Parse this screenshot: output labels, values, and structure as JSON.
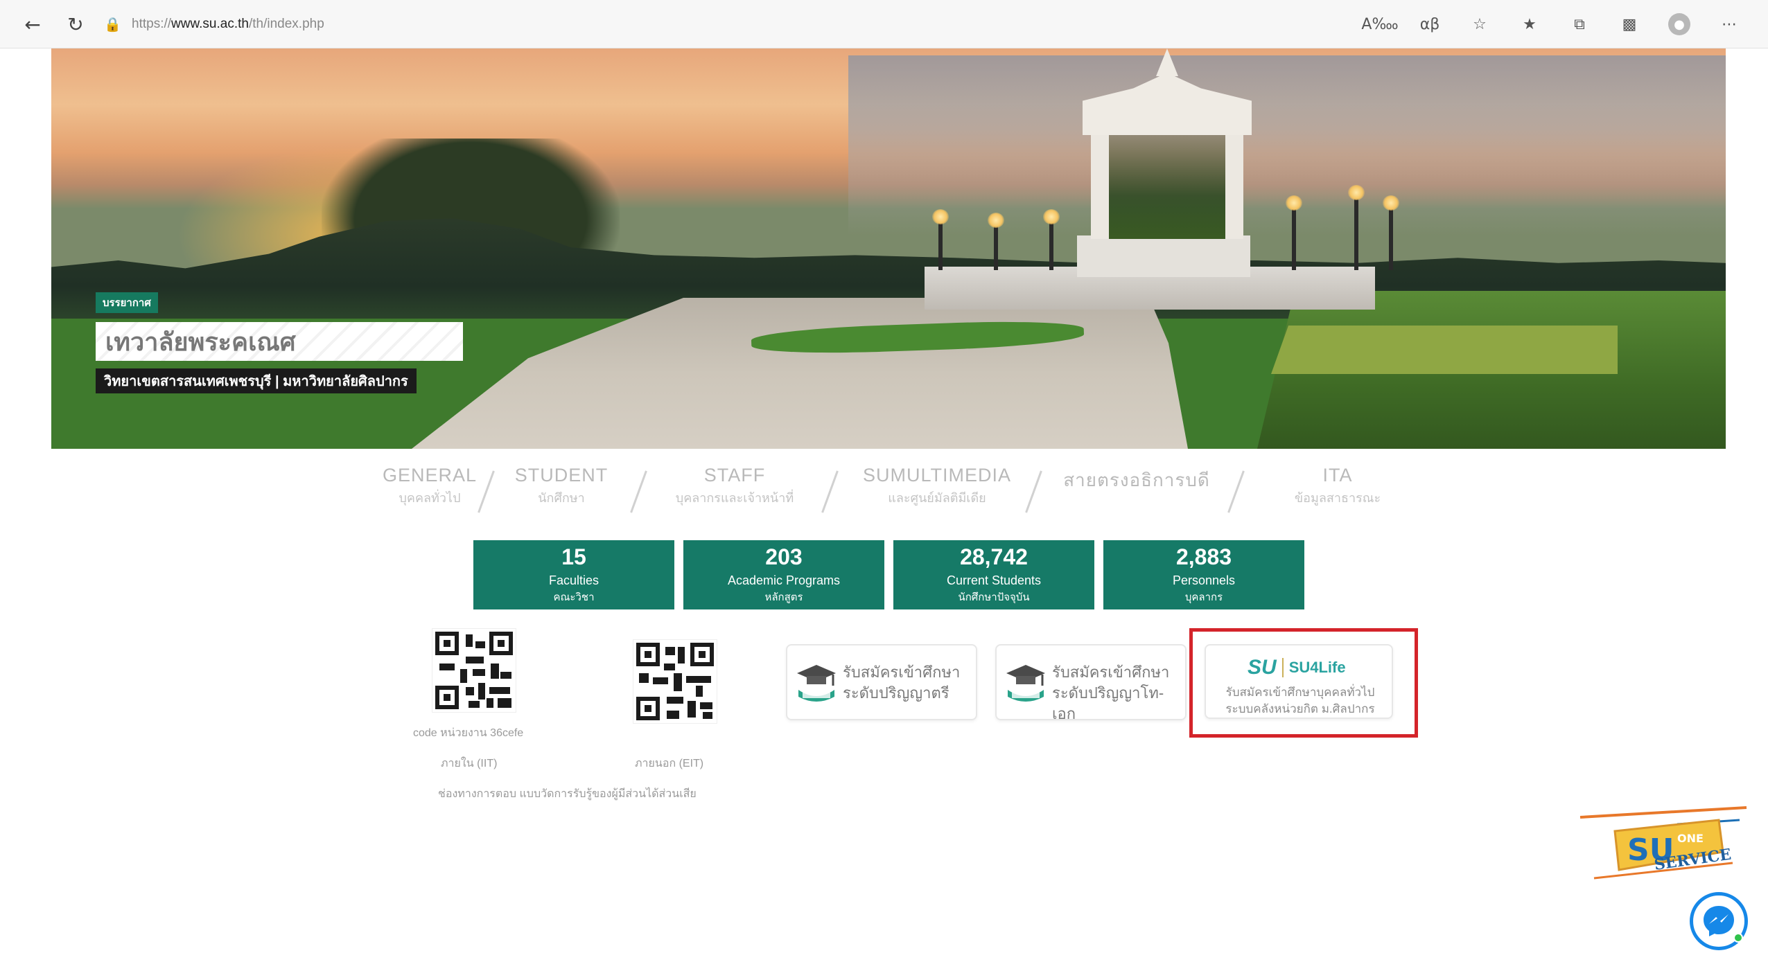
{
  "browser": {
    "url_prefix": "https://",
    "url_host": "www.su.ac.th",
    "url_path": "/th/index.php",
    "icons": [
      "back-icon",
      "reload-icon",
      "lock-icon",
      "read-aloud-icon",
      "translate-icon",
      "add-favorite-icon",
      "favorites-icon",
      "collections-icon",
      "extensions-icon",
      "profile-icon",
      "more-icon"
    ]
  },
  "hero": {
    "tag": "บรรยากาศ",
    "title": "เทวาลัยพระคเณศ",
    "subtitle": "วิทยาเขตสารสนเทศเพชรบุรี | มหาวิทยาลัยศิลปากร"
  },
  "categories": [
    {
      "en": "GENERAL",
      "th": "บุคคลทั่วไป"
    },
    {
      "en": "STUDENT",
      "th": "นักศึกษา"
    },
    {
      "en": "STAFF",
      "th": "บุคลากรและเจ้าหน้าที่"
    },
    {
      "en": "SUMULTIMEDIA",
      "th": "และศูนย์มัลติมีเดีย"
    },
    {
      "en": "สายตรงอธิการบดี",
      "th": ""
    },
    {
      "en": "ITA",
      "th": "ข้อมูลสาธารณะ"
    }
  ],
  "stats": [
    {
      "num": "15",
      "en": "Faculties",
      "th": "คณะวิชา"
    },
    {
      "num": "203",
      "en": "Academic Programs",
      "th": "หลักสูตร"
    },
    {
      "num": "28,742",
      "en": "Current Students",
      "th": "นักศึกษาปัจจุบัน"
    },
    {
      "num": "2,883",
      "en": "Personnels",
      "th": "บุคลากร"
    }
  ],
  "qr": {
    "code_label": "code หน่วยงาน 36cefe",
    "iit_label": "ภายใน (IIT)",
    "eit_label": "ภายนอก (EIT)",
    "caption": "ช่องทางการตอบ แบบวัดการรับรู้ของผู้มีส่วนได้ส่วนเสีย"
  },
  "services": {
    "bachelor": {
      "line1": "รับสมัครเข้าศึกษา",
      "line2": "ระดับปริญญาตรี"
    },
    "graduate": {
      "line1": "รับสมัครเข้าศึกษา",
      "line2": "ระดับปริญญาโท-เอก"
    },
    "su4life": {
      "mark": "SU",
      "name": "SU4Life",
      "line1": "รับสมัครเข้าศึกษาบุคคลทั่วไป",
      "line2": "ระบบคลังหน่วยกิต ม.ศิลปากร"
    }
  },
  "floating": {
    "one_stop_su": "SU",
    "one_stop_one": "ONE",
    "one_stop_service": "SERVICE"
  },
  "colors": {
    "primary_green": "#167a67",
    "highlight_red": "#d4242a",
    "su4life_teal": "#2aa3a0",
    "messenger_blue": "#1688e8"
  }
}
